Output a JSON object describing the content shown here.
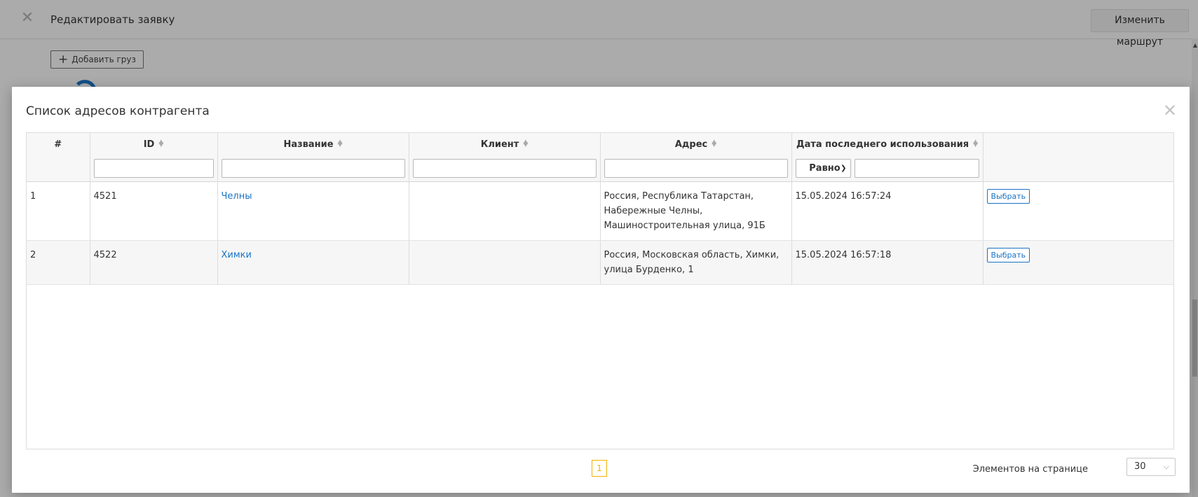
{
  "page": {
    "title": "Редактировать заявку",
    "route_button": "Изменить маршрут",
    "add_cargo_button": "Добавить груз"
  },
  "modal": {
    "title": "Список адресов контрагента",
    "columns": [
      "#",
      "ID",
      "Название",
      "Клиент",
      "Адрес",
      "Дата последнего использования",
      ""
    ],
    "date_filter_operator": "Равно",
    "rows": [
      {
        "num": "1",
        "id": "4521",
        "name": "Челны",
        "client": "",
        "address": "Россия, Республика Татарстан, Набережные Челны, Машиностроительная улица, 91Б",
        "last_used": "15.05.2024 16:57:24",
        "action": "Выбрать"
      },
      {
        "num": "2",
        "id": "4522",
        "name": "Химки",
        "client": "",
        "address": "Россия, Московская область, Химки, улица Бурденко, 1",
        "last_used": "15.05.2024 16:57:18",
        "action": "Выбрать"
      }
    ],
    "pagination": {
      "current_page": "1",
      "page_size_label": "Элементов на странице",
      "page_size": "30"
    }
  },
  "icons": {
    "page_close": "close-icon",
    "modal_close": "close-icon",
    "add": "plus-icon",
    "sort": "sort-icon",
    "dropdown": "chevron-down-icon"
  },
  "colors": {
    "link": "#1a73c6",
    "active_page": "#f0b400",
    "backdrop": "rgba(0,0,0,0.33)"
  }
}
